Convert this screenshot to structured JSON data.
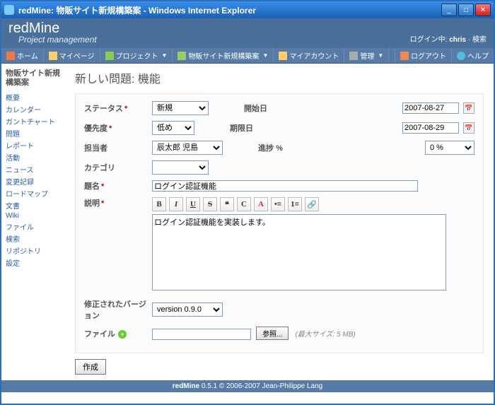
{
  "window": {
    "title": "redMine: 物販サイト新規構築案 - Windows Internet Explorer"
  },
  "brand": {
    "name": "redMine",
    "slogan": "Project management"
  },
  "login": {
    "prefix": "ログイン中: ",
    "user": "chris",
    "search": "検索"
  },
  "menu": {
    "home": "ホーム",
    "mypage": "マイページ",
    "projects": "プロジェクト",
    "project": "物販サイト新規構築案",
    "account": "マイアカウント",
    "admin": "管理",
    "logout": "ログアウト",
    "help": "ヘルプ"
  },
  "sidebar": {
    "title": "物販サイト新規構築案",
    "items": [
      "概要",
      "カレンダー",
      "ガントチャート",
      "問題",
      "レポート",
      "活動",
      "ニュース",
      "変更記録",
      "ロードマップ",
      "文書",
      "Wiki",
      "ファイル",
      "検索",
      "リポジトリ",
      "設定"
    ]
  },
  "page": {
    "heading": "新しい問題: 機能"
  },
  "form": {
    "labels": {
      "status": "ステータス",
      "priority": "優先度",
      "assignee": "担当者",
      "category": "カテゴリ",
      "subject": "題名",
      "description": "説明",
      "start": "開始日",
      "due": "期限日",
      "done": "進捗",
      "percent": "%",
      "version": "修正されたバージョン",
      "file": "ファイル"
    },
    "values": {
      "status": "新規",
      "priority": "低め",
      "assignee": "辰太郎 児島",
      "category": "",
      "subject": "ログイン認証機能",
      "description": "ログイン認証機能を実装します。",
      "start": "2007-08-27",
      "due": "2007-08-29",
      "done": "0 %",
      "version": "version 0.9.0",
      "file": ""
    },
    "browse": "参照...",
    "filehint": "(最大サイズ: 5 MB)",
    "submit": "作成"
  },
  "footer": {
    "app": "redMine",
    "rest": " 0.5.1 © 2006-2007 Jean-Philippe Lang"
  }
}
